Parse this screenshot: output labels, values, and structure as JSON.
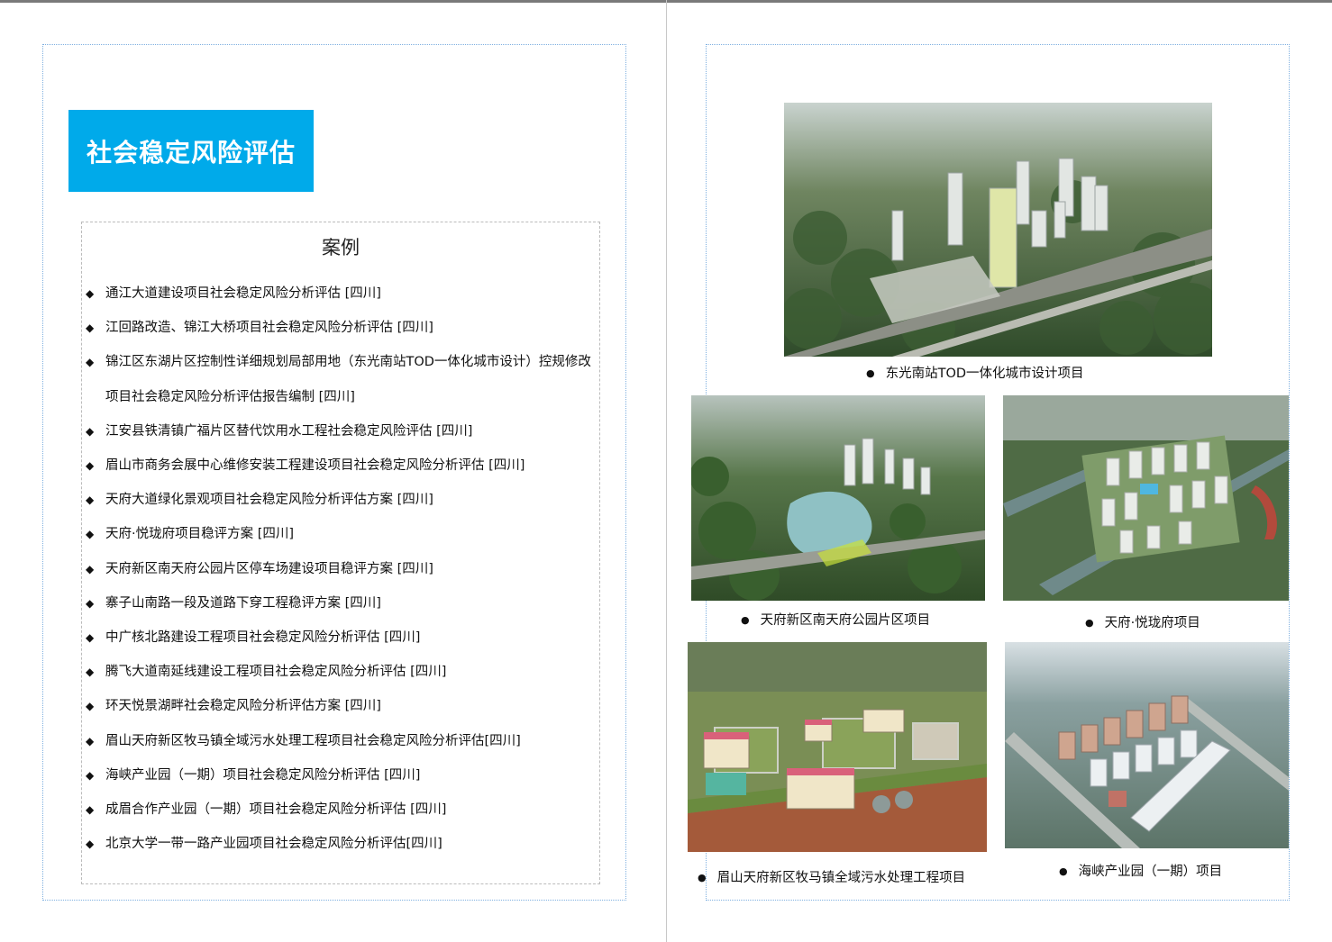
{
  "left_page": {
    "title": "社会稳定风险评估",
    "case_heading": "案例",
    "bullet": "◆",
    "cases": [
      "通江大道建设项目社会稳定风险分析评估 [四川]",
      "江回路改造、锦江大桥项目社会稳定风险分析评估 [四川]",
      "锦江区东湖片区控制性详细规划局部用地（东光南站TOD一体化城市设计）控规修改项目社会稳定风险分析评估报告编制 [四川]",
      "江安县铁清镇广福片区替代饮用水工程社会稳定风险评估 [四川]",
      "眉山市商务会展中心维修安装工程建设项目社会稳定风险分析评估 [四川]",
      "天府大道绿化景观项目社会稳定风险分析评估方案 [四川]",
      "天府·悦珑府项目稳评方案 [四川]",
      "天府新区南天府公园片区停车场建设项目稳评方案 [四川]",
      "寨子山南路一段及道路下穿工程稳评方案 [四川]",
      "中广核北路建设工程项目社会稳定风险分析评估 [四川]",
      "腾飞大道南延线建设工程项目社会稳定风险分析评估 [四川]",
      "环天悦景湖畔社会稳定风险分析评估方案 [四川]",
      "眉山天府新区牧马镇全域污水处理工程项目社会稳定风险分析评估[四川]",
      "海峡产业园（一期）项目社会稳定风险分析评估 [四川]",
      "成眉合作产业园（一期）项目社会稳定风险分析评估 [四川]",
      "北京大学一带一路产业园项目社会稳定风险分析评估[四川]"
    ]
  },
  "right_page": {
    "caption_bullet": "●",
    "captions": [
      "东光南站TOD一体化城市设计项目",
      "天府新区南天府公园片区项目",
      "天府·悦珑府项目",
      "眉山天府新区牧马镇全域污水处理工程项目",
      "海峡产业园（一期）项目"
    ]
  },
  "colors": {
    "title_background": "#00aaea",
    "frame_border": "#7fb0e0"
  }
}
